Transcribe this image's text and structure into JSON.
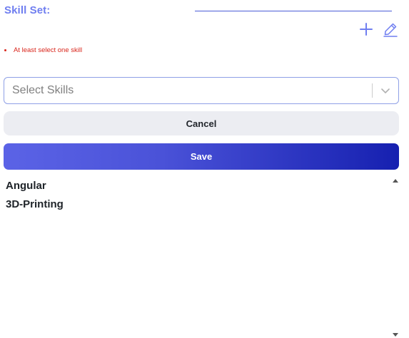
{
  "header": {
    "title": "Skill Set:"
  },
  "icons": {
    "add": "plus-icon",
    "edit": "pencil-icon",
    "accent_color": "#6f7ef0"
  },
  "errors": [
    "At least select one skill"
  ],
  "select": {
    "placeholder": "Select Skills"
  },
  "buttons": {
    "cancel": "Cancel",
    "save": "Save"
  },
  "skills": [
    "Angular",
    "3D-Printing"
  ],
  "colors": {
    "error": "#d9261c",
    "save_gradient_start": "#5b63e6",
    "save_gradient_end": "#1620b0",
    "cancel_bg": "#ecedf2"
  }
}
